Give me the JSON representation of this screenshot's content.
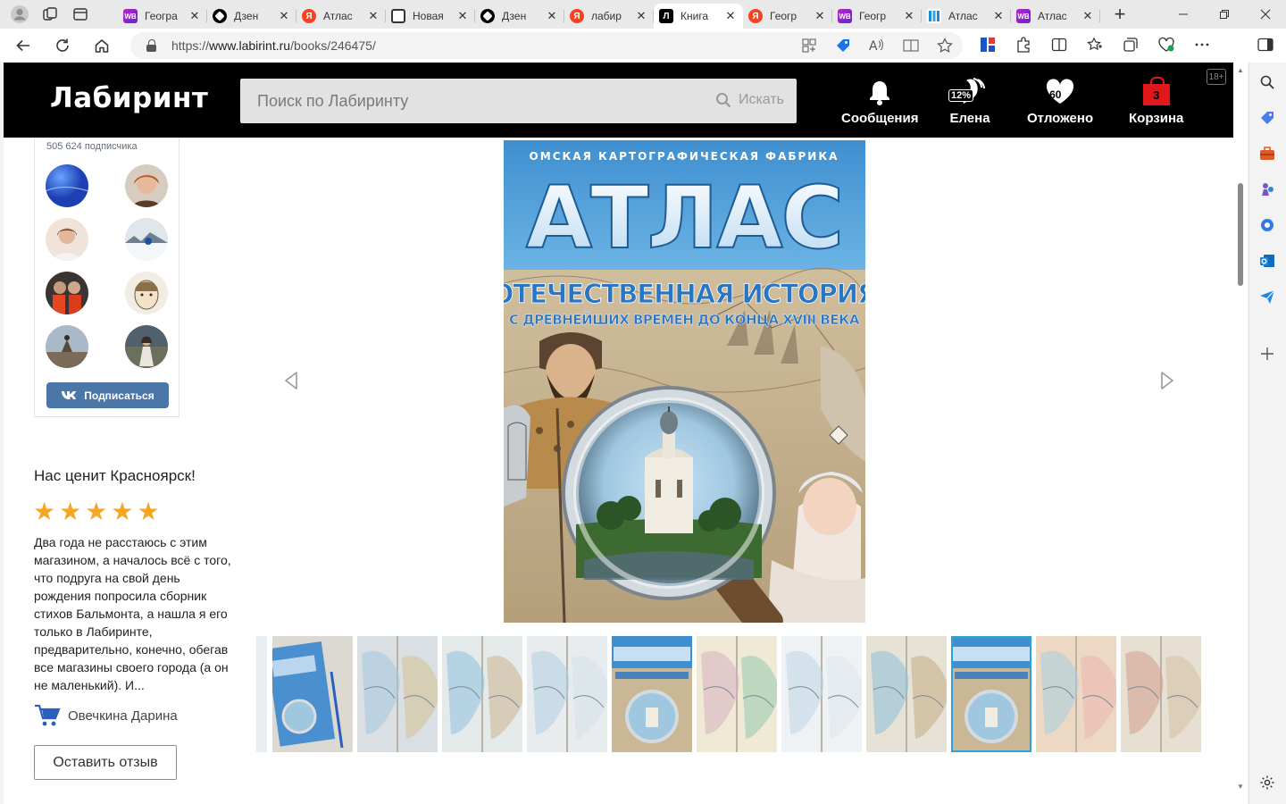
{
  "browser": {
    "tabs": [
      {
        "icon": "wb",
        "title": "Геогра"
      },
      {
        "icon": "dzen",
        "title": "Дзен"
      },
      {
        "icon": "ya",
        "title": "Атлас"
      },
      {
        "icon": "news",
        "title": "Новая"
      },
      {
        "icon": "dzen",
        "title": "Дзен"
      },
      {
        "icon": "ya",
        "title": "лабир"
      },
      {
        "icon": "lab",
        "title": "Книга",
        "active": true
      },
      {
        "icon": "ya",
        "title": "Геогр"
      },
      {
        "icon": "wb",
        "title": "Геогр"
      },
      {
        "icon": "atl",
        "title": "Атлас"
      },
      {
        "icon": "wb",
        "title": "Атлас"
      }
    ],
    "url_prefix": "https://",
    "url_host": "www.labirint.ru",
    "url_path": "/books/246475/"
  },
  "site": {
    "logo": "Лабиринт",
    "search_placeholder": "Поиск по Лабиринту",
    "search_button": "Искать",
    "nav": {
      "messages": "Сообщения",
      "profile": "Елена",
      "profile_discount": "12%",
      "postponed": "Отложено",
      "postponed_count": "60",
      "cart": "Корзина",
      "cart_count": "3"
    },
    "age_rating": "18+"
  },
  "vk_widget": {
    "subscribers": "505 624 подписчика",
    "subscribe_button": "Подписаться"
  },
  "review": {
    "title": "Нас ценит Красноярск!",
    "rating": 5,
    "text": "Два года не расстаюсь с этим магазином, а началось всё с того, что подруга на свой день рождения попросила сборник стихов Бальмонта, а нашла я его только в Лабиринте, предварительно, конечно, обегав все магазины своего города (а он не маленький). И...",
    "author": "Овечкина Дарина",
    "leave_review_button": "Оставить отзыв"
  },
  "book_cover": {
    "publisher": "ОМСКАЯ КАРТОГРАФИЧЕСКАЯ ФАБРИКА",
    "title": "АТЛАС",
    "subtitle": "ОТЕЧЕСТВЕННАЯ ИСТОРИЯ",
    "subtitle2": "С ДРЕВНЕЙШИХ ВРЕМЕН ДО КОНЦА XVIII ВЕКА"
  },
  "gallery": {
    "selected_index": 8,
    "thumb_count": 11
  },
  "colors": {
    "accent_vk": "#4a76a8",
    "star": "#f6a623",
    "cart_red": "#e3171b",
    "thumb_selected": "#2ea2d8"
  }
}
